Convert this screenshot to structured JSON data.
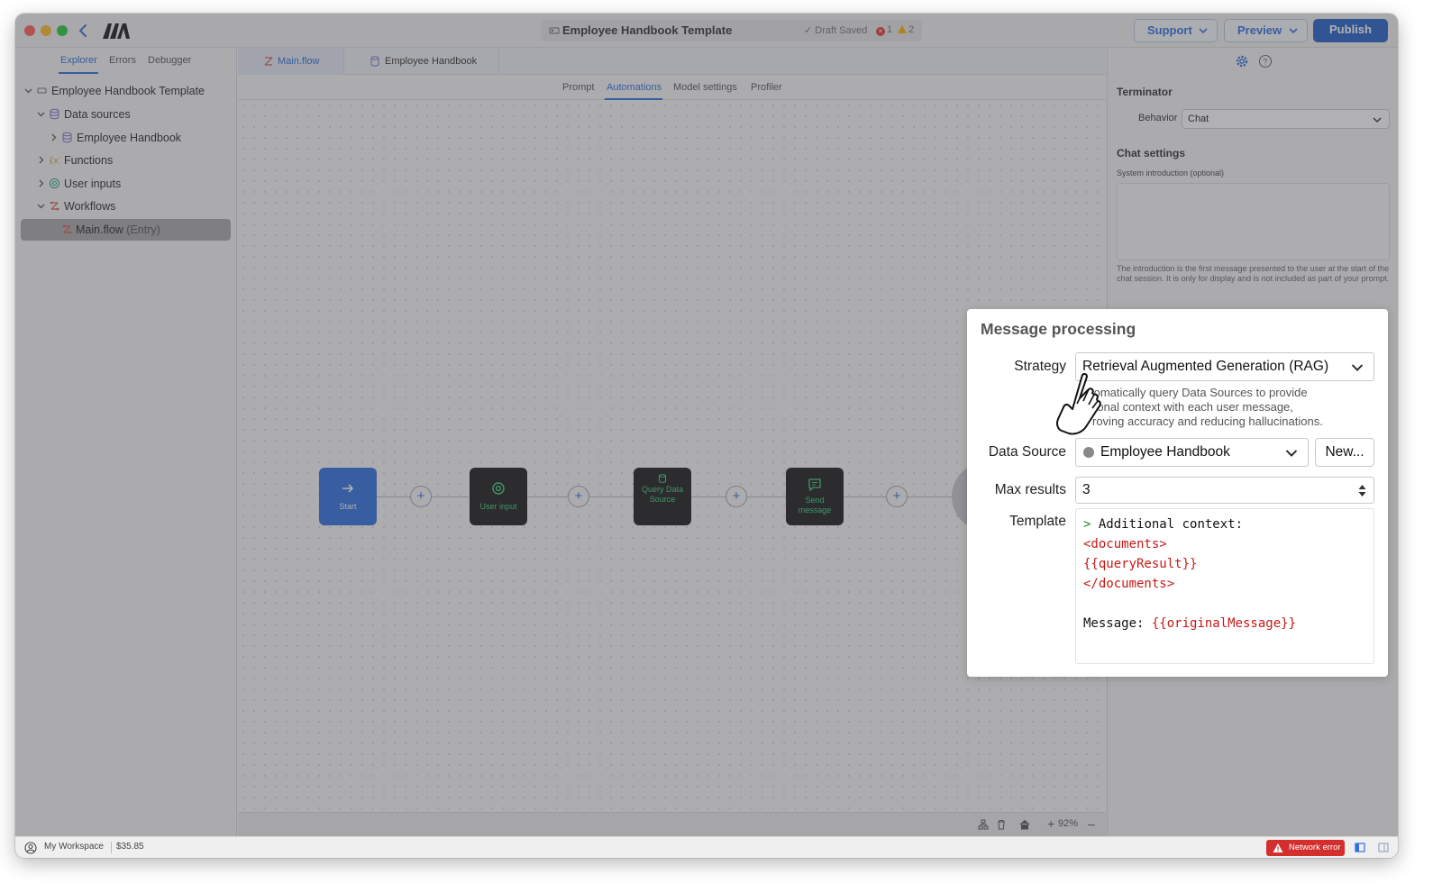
{
  "titlebar": {
    "document_title": "Employee Handbook Template",
    "draft_status": "✓ Draft Saved",
    "error_count": "1",
    "warning_count": "2",
    "support_label": "Support",
    "preview_label": "Preview",
    "publish_label": "Publish"
  },
  "left_panel": {
    "tabs": [
      "Explorer",
      "Errors",
      "Debugger"
    ],
    "active_tab": "Explorer",
    "tree": {
      "root": "Employee Handbook Template",
      "data_sources": "Data sources",
      "employee_handbook": "Employee Handbook",
      "functions": "Functions",
      "user_inputs": "User inputs",
      "workflows": "Workflows",
      "main_flow": "Main.flow",
      "entry_tag": "(Entry)"
    }
  },
  "center": {
    "file_tabs": [
      "Main.flow",
      "Employee Handbook"
    ],
    "sub_tabs": [
      "Prompt",
      "Automations",
      "Model settings",
      "Profiler"
    ],
    "active_sub_tab": "Automations",
    "nodes": {
      "start": "Start",
      "user_input": "User input",
      "query_data_source": "Query Data Source",
      "send_message": "Send message"
    },
    "zoom": "92%"
  },
  "right_panel": {
    "terminator_heading": "Terminator",
    "behavior_label": "Behavior",
    "behavior_value": "Chat",
    "chat_settings_heading": "Chat settings",
    "system_intro_label": "System introduction (optional)",
    "system_intro_help": "The introduction is the first message presented to the user at the start of the chat session. It is only for display and is not included as part of your prompt."
  },
  "message_processing": {
    "title": "Message processing",
    "strategy_label": "Strategy",
    "strategy_value": "Retrieval Augmented Generation (RAG)",
    "strategy_description": "...omatically query Data Sources to provide ...tional context with each user message, ...proving accuracy and reducing hallucinations.",
    "desc_line1": "tomatically query Data Sources to provide",
    "desc_line2": "itional context with each user message,",
    "desc_line3": "roving accuracy and reducing hallucinations.",
    "data_source_label": "Data Source",
    "data_source_value": "Employee Handbook",
    "new_button": "New...",
    "max_results_label": "Max results",
    "max_results_value": "3",
    "template_label": "Template",
    "template_lines": {
      "l1_prefix": ">",
      "l1_text": " Additional context:",
      "l2": "<documents>",
      "l3": "{{queryResult}}",
      "l4": "</documents>",
      "l6_prefix": "Message: ",
      "l6_var": "{{originalMessage}}"
    }
  },
  "statusbar": {
    "workspace": "My Workspace",
    "balance": "$35.85",
    "network_error": "Network error"
  },
  "colors": {
    "accent": "#2f6fde",
    "publish": "#2360c9",
    "error": "#d32f2f",
    "node_green": "#3ecf7f"
  }
}
